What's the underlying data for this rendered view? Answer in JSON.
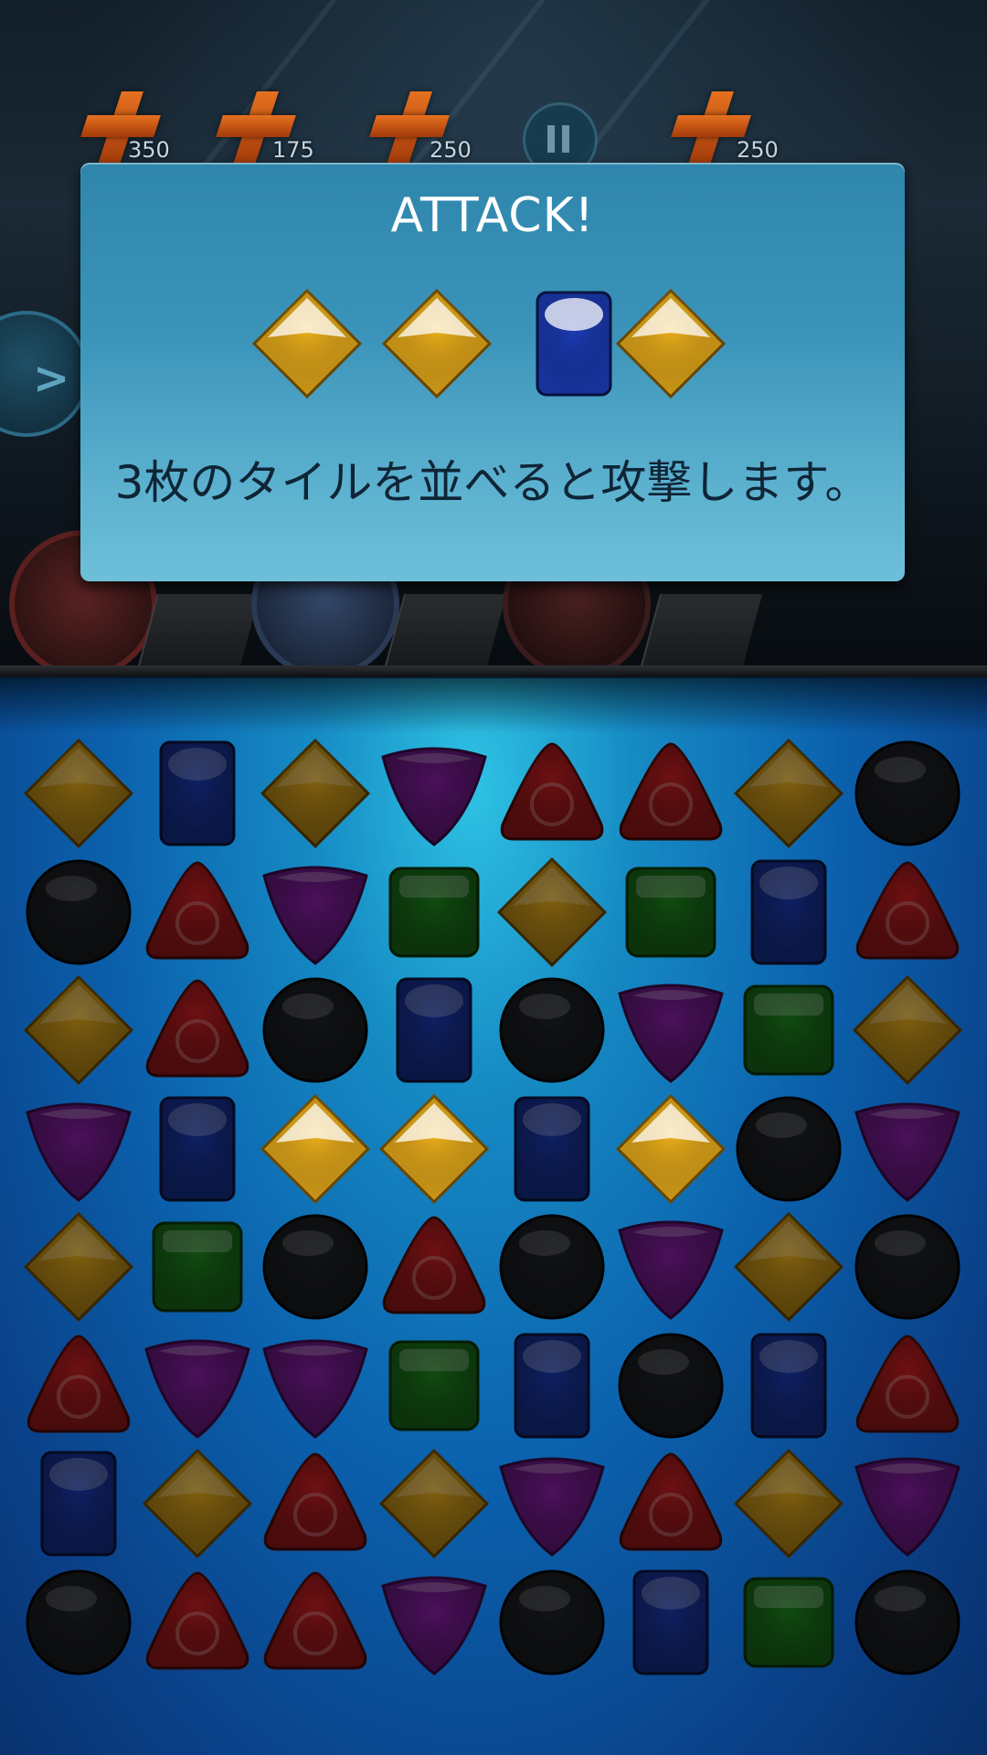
{
  "hud": {
    "costs": [
      "350",
      "175",
      "250",
      "250"
    ],
    "pause_icon": "pause-icon",
    "next_icon": "next-arrow-icon"
  },
  "dialog": {
    "title": "ATTACK!",
    "gems": [
      "yellow",
      "yellow",
      "blue",
      "yellow"
    ],
    "message": "3枚のタイルを並べると攻撃します。"
  },
  "board": {
    "rows": [
      [
        "yellow",
        "blue",
        "yellow",
        "purple",
        "red",
        "red",
        "yellow",
        "black"
      ],
      [
        "black",
        "red",
        "purple",
        "green",
        "yellow",
        "green",
        "blue",
        "red"
      ],
      [
        "yellow",
        "red",
        "black",
        "blue",
        "black",
        "purple",
        "green",
        "yellow"
      ],
      [
        "purple",
        "blue",
        "yellow",
        "yellow",
        "blue",
        "yellow",
        "black",
        "purple"
      ],
      [
        "yellow",
        "green",
        "black",
        "red",
        "black",
        "purple",
        "yellow",
        "black"
      ],
      [
        "red",
        "purple",
        "purple",
        "green",
        "blue",
        "black",
        "blue",
        "red"
      ],
      [
        "blue",
        "yellow",
        "red",
        "yellow",
        "purple",
        "red",
        "yellow",
        "purple"
      ],
      [
        "black",
        "red",
        "red",
        "purple",
        "black",
        "blue",
        "green",
        "black"
      ]
    ],
    "highlighted": [
      [
        3,
        2
      ],
      [
        3,
        3
      ],
      [
        3,
        5
      ]
    ]
  },
  "colors": {
    "yellow": "#f0b21c",
    "blue": "#1c3cb8",
    "purple": "#8a1fa8",
    "red": "#c81e22",
    "green": "#1f8a1f",
    "black": "#202327"
  }
}
